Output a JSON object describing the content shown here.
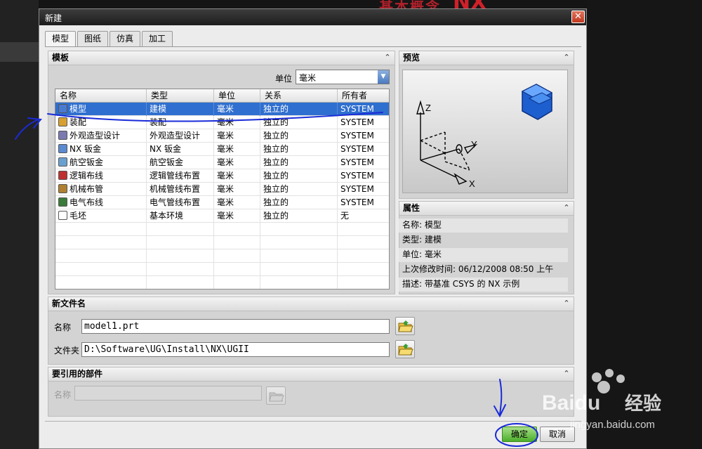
{
  "background": {
    "title": "基本概念",
    "nx": "NX"
  },
  "dialog": {
    "title": "新建",
    "close_symbol": "✕",
    "tabs": [
      {
        "label": "模型",
        "active": true
      },
      {
        "label": "图纸",
        "active": false
      },
      {
        "label": "仿真",
        "active": false
      },
      {
        "label": "加工",
        "active": false
      }
    ],
    "templates": {
      "header": "模板",
      "unit_label": "单位",
      "unit_value": "毫米",
      "columns": [
        "名称",
        "类型",
        "单位",
        "关系",
        "所有者"
      ],
      "rows": [
        {
          "name": "模型",
          "type": "建模",
          "unit": "毫米",
          "relation": "独立的",
          "owner": "SYSTEM",
          "selected": true,
          "icon": "model-icon"
        },
        {
          "name": "装配",
          "type": "装配",
          "unit": "毫米",
          "relation": "独立的",
          "owner": "SYSTEM",
          "selected": false,
          "icon": "assembly-icon"
        },
        {
          "name": "外观造型设计",
          "type": "外观造型设计",
          "unit": "毫米",
          "relation": "独立的",
          "owner": "SYSTEM",
          "selected": false,
          "icon": "shape-studio-icon"
        },
        {
          "name": "NX 钣金",
          "type": "NX 钣金",
          "unit": "毫米",
          "relation": "独立的",
          "owner": "SYSTEM",
          "selected": false,
          "icon": "sheet-metal-icon"
        },
        {
          "name": "航空钣金",
          "type": "航空钣金",
          "unit": "毫米",
          "relation": "独立的",
          "owner": "SYSTEM",
          "selected": false,
          "icon": "aero-sheet-metal-icon"
        },
        {
          "name": "逻辑布线",
          "type": "逻辑管线布置",
          "unit": "毫米",
          "relation": "独立的",
          "owner": "SYSTEM",
          "selected": false,
          "icon": "logical-routing-icon"
        },
        {
          "name": "机械布管",
          "type": "机械管线布置",
          "unit": "毫米",
          "relation": "独立的",
          "owner": "SYSTEM",
          "selected": false,
          "icon": "mechanical-piping-icon"
        },
        {
          "name": "电气布线",
          "type": "电气管线布置",
          "unit": "毫米",
          "relation": "独立的",
          "owner": "SYSTEM",
          "selected": false,
          "icon": "electrical-routing-icon"
        },
        {
          "name": "毛坯",
          "type": "基本环境",
          "unit": "毫米",
          "relation": "独立的",
          "owner": "无",
          "selected": false,
          "icon": "blank-icon"
        }
      ]
    },
    "preview": {
      "header": "预览",
      "axes": [
        "Z",
        "Y",
        "X"
      ]
    },
    "properties": {
      "header": "属性",
      "items": [
        {
          "label": "名称:",
          "value": "模型"
        },
        {
          "label": "类型:",
          "value": "建模"
        },
        {
          "label": "单位:",
          "value": "毫米"
        },
        {
          "label": "上次修改时间:",
          "value": "06/12/2008 08:50 上午"
        },
        {
          "label": "描述:",
          "value": "带基准 CSYS 的 NX 示例"
        }
      ]
    },
    "new_file": {
      "header": "新文件名",
      "name_label": "名称",
      "name_value": "model1.prt",
      "folder_label": "文件夹",
      "folder_value": "D:\\Software\\UG\\Install\\NX\\UGII"
    },
    "reference": {
      "header": "要引用的部件",
      "name_label": "名称",
      "name_value": ""
    },
    "buttons": {
      "ok": "确定",
      "cancel": "取消"
    }
  },
  "watermark": {
    "brand": "Baidu",
    "brand_cn": "经验",
    "url": "jingyan.baidu.com"
  },
  "colors": {
    "selection": "#2f6fcf",
    "annotation": "#1a2bd8",
    "ok": "#4cae2a"
  }
}
